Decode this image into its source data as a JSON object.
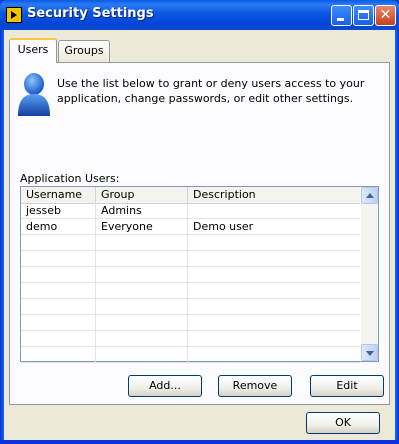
{
  "window": {
    "title": "Security Settings",
    "controls": [
      "minimize-icon",
      "maximize-icon",
      "close-icon"
    ],
    "close_glyph": "✕"
  },
  "tabs": [
    {
      "label": "Users",
      "active": true
    },
    {
      "label": "Groups",
      "active": false
    }
  ],
  "users_tab": {
    "icon": "user-icon",
    "intro": "Use the list below to grant or deny users access to your application, change passwords, or edit other settings.",
    "list_label": "Application Users:",
    "columns": [
      "Username",
      "Group",
      "Description"
    ],
    "rows": [
      [
        "jesseb",
        "Admins",
        ""
      ],
      [
        "demo",
        "Everyone",
        "Demo user"
      ],
      [
        "",
        "",
        ""
      ],
      [
        "",
        "",
        ""
      ],
      [
        "",
        "",
        ""
      ],
      [
        "",
        "",
        ""
      ],
      [
        "",
        "",
        ""
      ],
      [
        "",
        "",
        ""
      ],
      [
        "",
        "",
        ""
      ],
      [
        "",
        "",
        ""
      ]
    ],
    "buttons": {
      "add": "Add...",
      "remove": "Remove",
      "edit": "Edit"
    }
  },
  "footer": {
    "ok": "OK"
  },
  "colors": {
    "titlebar": "#0a56e0",
    "dialog_bg": "#ece9d8",
    "tab_highlight": "#ffc83c"
  }
}
